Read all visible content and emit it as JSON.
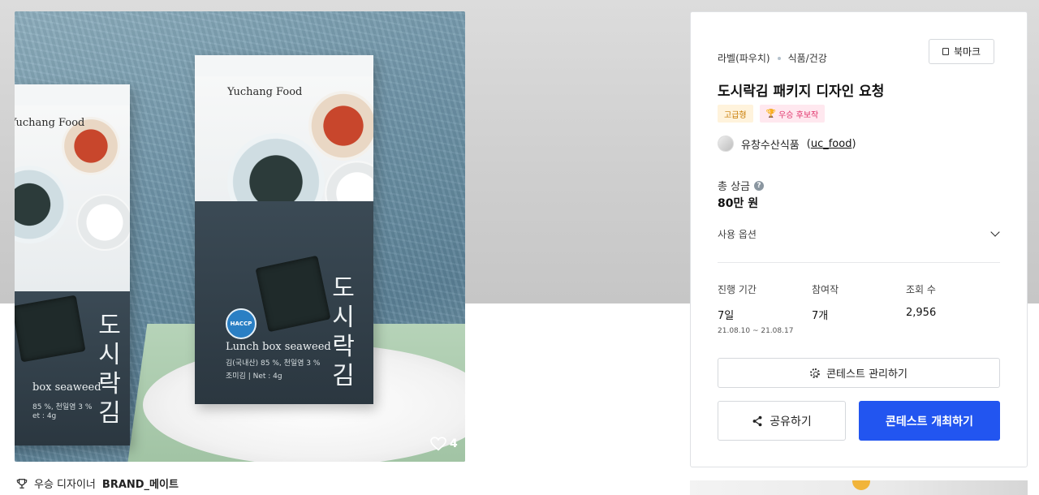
{
  "image": {
    "alt": "",
    "pack_front": {
      "brand": "Yuchang Food",
      "title_chars": [
        "도",
        "시",
        "락",
        "김"
      ],
      "english_name": "Lunch box seaweed",
      "ingredients": "김(국내산) 85 %, 천일염 3 %",
      "net": "조미김 | Net : 4g",
      "badge": "HACCP"
    },
    "pack_back": {
      "brand": "Yuchang Food",
      "title_chars": [
        "도",
        "시",
        "락",
        "김"
      ],
      "english_name": "box seaweed",
      "ingredients": "85 %, 천일염 3 %",
      "net": "et : 4g"
    },
    "like_count": "4"
  },
  "winner": {
    "label": "우승 디자이너",
    "name": "BRAND_메이트"
  },
  "contest": {
    "breadcrumb": [
      "라벨(파우치)",
      "식품/건강"
    ],
    "bookmark_label": "북마크",
    "title": "도시락김 패키지 디자인 요청",
    "tags": [
      {
        "label": "고급형",
        "icon": ""
      },
      {
        "label": "우승 후보작",
        "icon": "trophy-icon"
      }
    ],
    "host": {
      "name": "유창수산식품",
      "handle": "uc_food"
    },
    "prize": {
      "label": "총 상금",
      "value": "80만 원"
    },
    "options_label": "사용 옵션",
    "stats": [
      {
        "label": "진행 기간",
        "value": "7일",
        "sub": "21.08.10 ~ 21.08.17"
      },
      {
        "label": "참여작",
        "value": "7개",
        "sub": ""
      },
      {
        "label": "조회 수",
        "value": "2,956",
        "sub": ""
      }
    ],
    "buttons": {
      "manage": "콘테스트 관리하기",
      "share": "공유하기",
      "host": "콘테스트 개최하기"
    }
  },
  "colors": {
    "primary": "#2255f0",
    "grade_tag": "#c77a00",
    "award_tag": "#e0336b"
  }
}
